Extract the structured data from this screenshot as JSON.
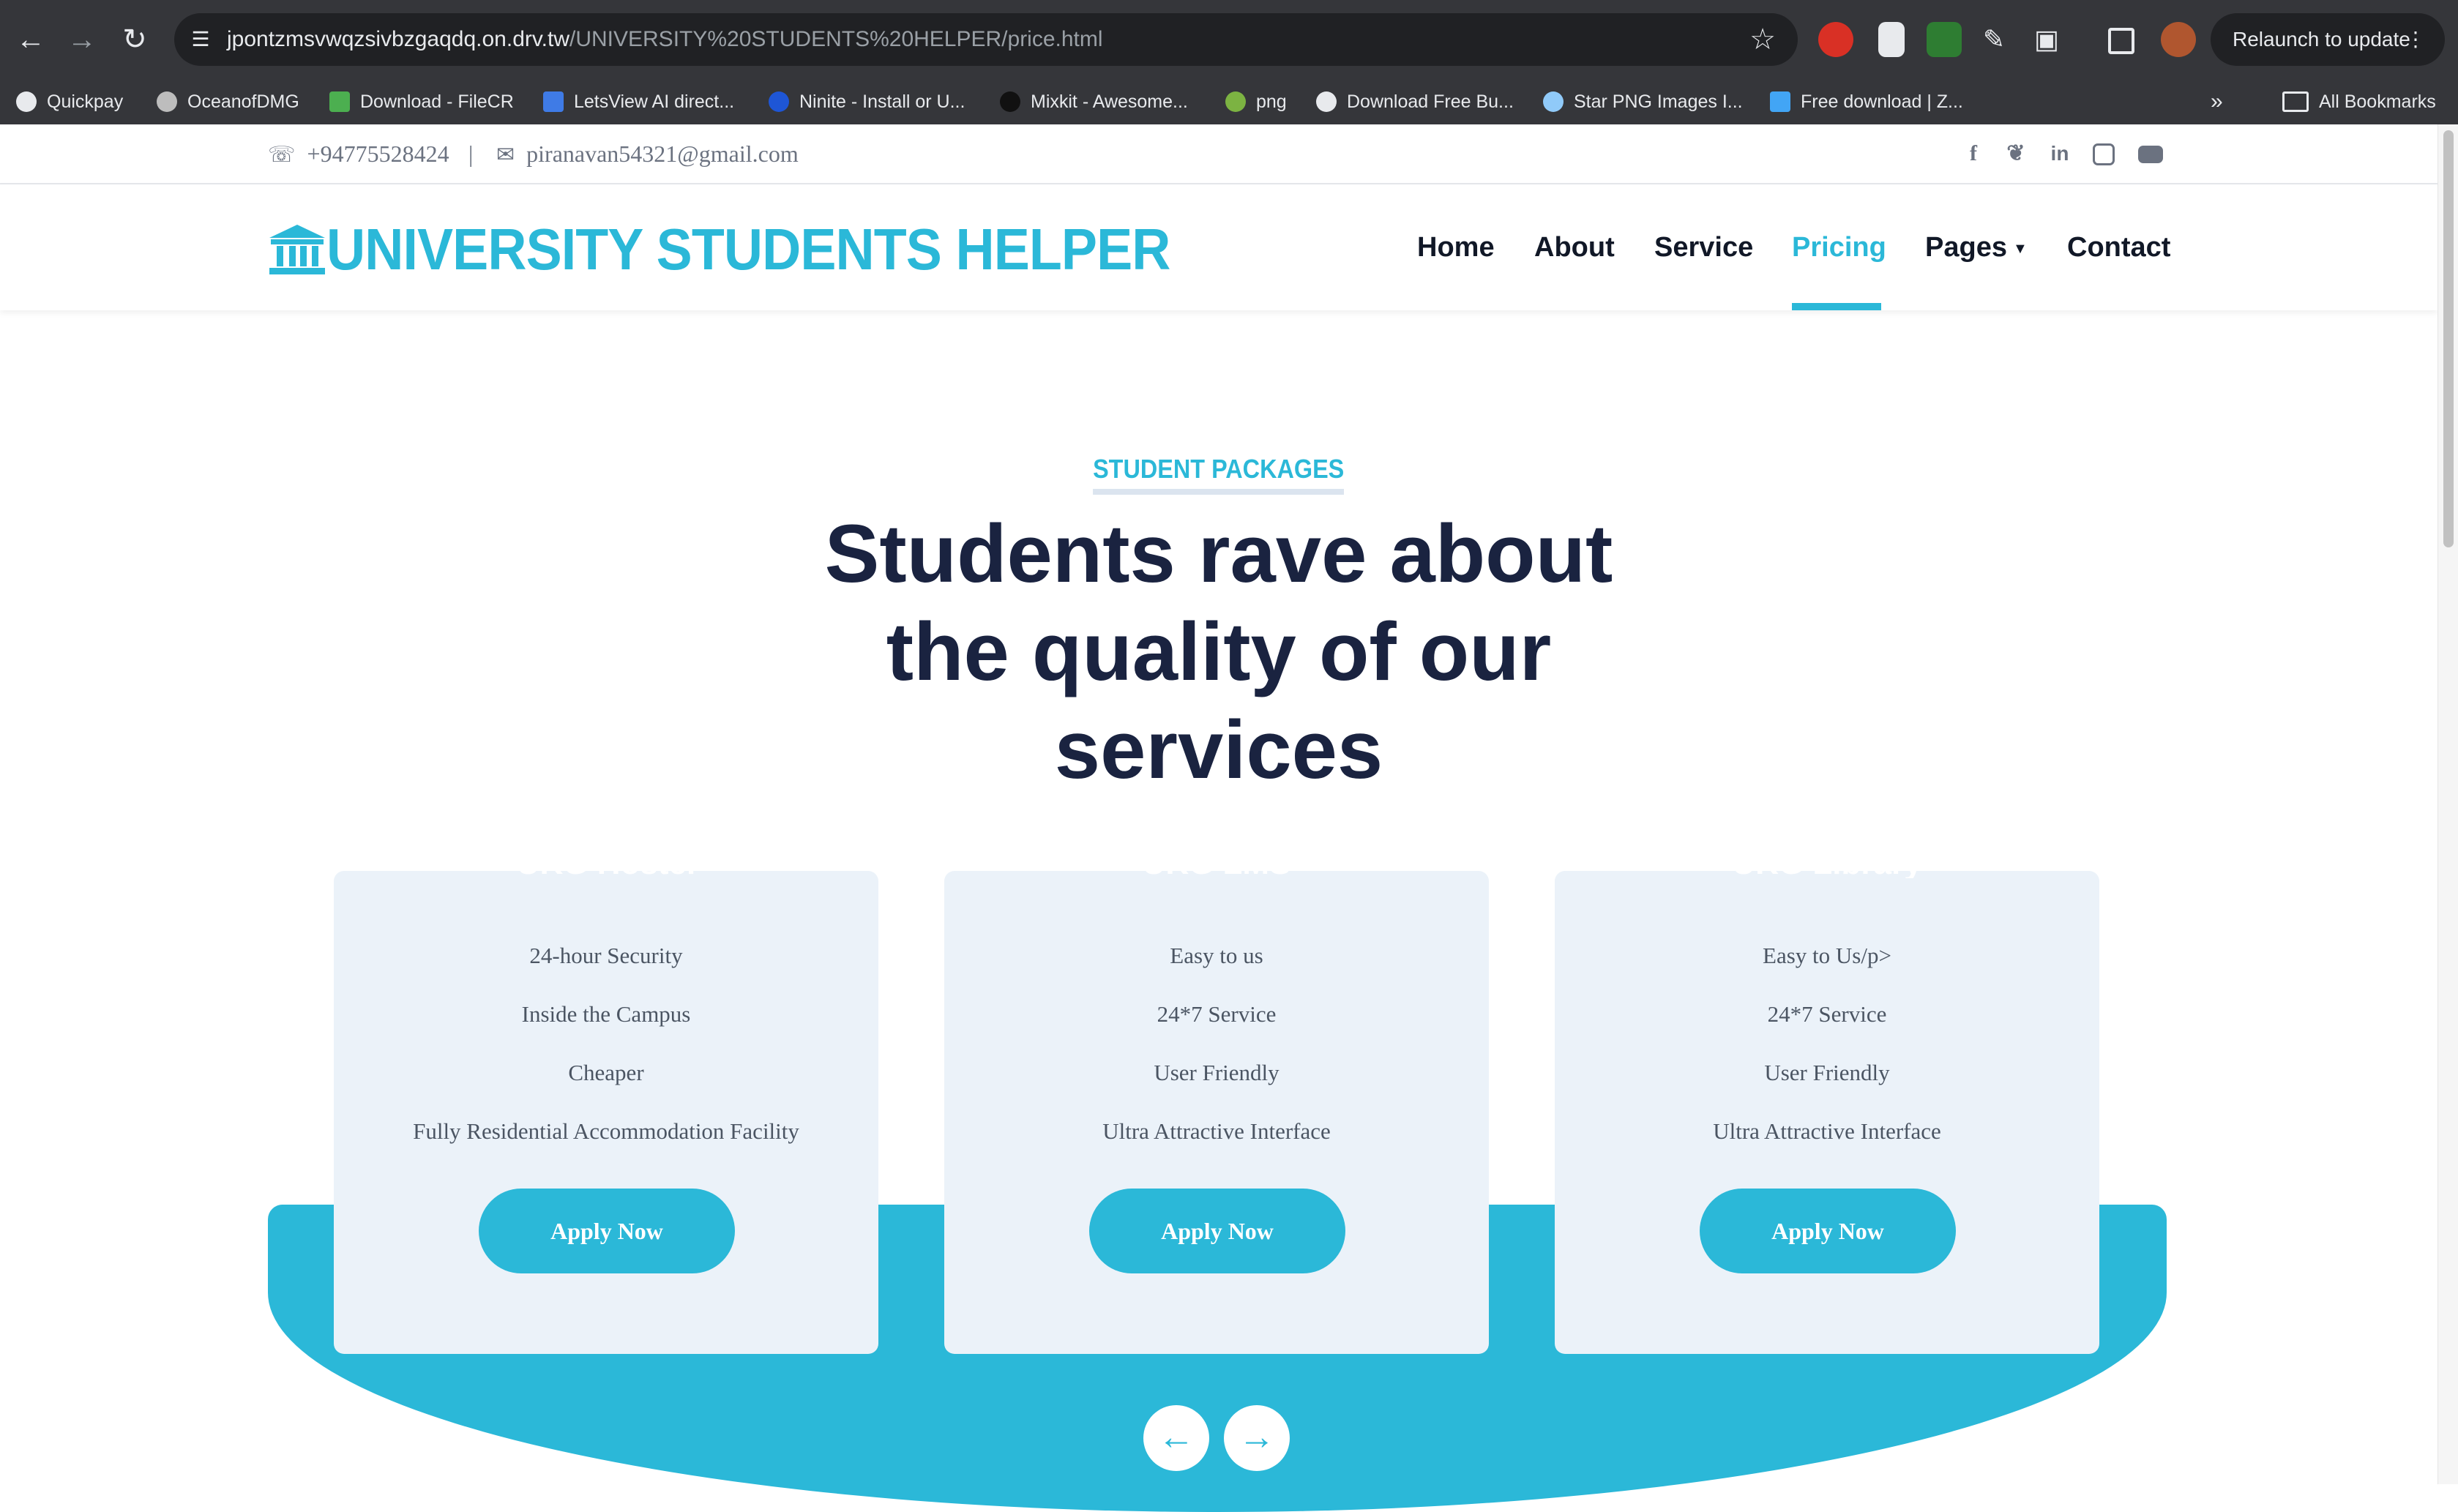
{
  "browser": {
    "url_host": "jpontzmsvwqzsivbzgaqdq.on.drv.tw",
    "url_path": "/UNIVERSITY%20STUDENTS%20HELPER/price.html",
    "relaunch_label": "Relaunch to update",
    "bookmarks": [
      "Quickpay",
      "OceanofDMG",
      "Download - FileCR",
      "LetsView AI direct...",
      "Ninite - Install or U...",
      "Mixkit - Awesome...",
      "png",
      "Download Free Bu...",
      "Star PNG Images I...",
      "Free download | Z..."
    ],
    "all_bookmarks": "All Bookmarks"
  },
  "topbar": {
    "phone": "+94775528424",
    "separator": "|",
    "email": "piranavan54321@gmail.com"
  },
  "brand": {
    "name": "UNIVERSITY STUDENTS HELPER"
  },
  "nav": {
    "home": "Home",
    "about": "About",
    "service": "Service",
    "pricing": "Pricing",
    "pages": "Pages",
    "contact": "Contact",
    "active": "Pricing"
  },
  "section": {
    "kicker": "STUDENT PACKAGES",
    "heading": "Students rave about the quality of our services"
  },
  "cards": [
    {
      "title": "UKG Hostel",
      "features": [
        "24-hour Security",
        "Inside the Campus",
        "Cheaper",
        "Fully Residential Accommodation Facility"
      ],
      "button": "Apply Now"
    },
    {
      "title": "UKG LMS",
      "features": [
        "Easy to us",
        "24*7 Service",
        "User Friendly",
        "Ultra Attractive Interface"
      ],
      "button": "Apply Now"
    },
    {
      "title": "UKG Library",
      "features": [
        "Easy to Us/p>",
        "24*7 Service",
        "User Friendly",
        "Ultra Attractive Interface"
      ],
      "button": "Apply Now"
    }
  ],
  "carousel": {
    "prev_icon": "arrow-left-icon",
    "next_icon": "arrow-right-icon"
  },
  "colors": {
    "accent": "#2bb8d8",
    "heading": "#1a2340",
    "card_bg": "#ebf2f9"
  }
}
